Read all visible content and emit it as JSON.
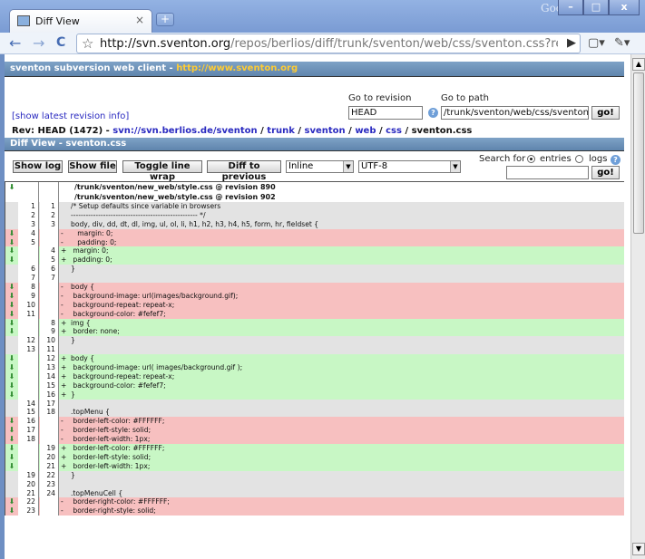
{
  "browser": {
    "tab_title": "Diff View",
    "tab_close": "×",
    "new_tab": "+",
    "brand": "Google",
    "win_minimize": "–",
    "win_maximize": "□",
    "win_close": "x",
    "back": "←",
    "forward": "→",
    "reload": "C",
    "url_host": "http://svn.sventon.org",
    "url_rest": "/repos/berlios/diff/trunk/sventon/web/css/sventon.css?revision=HEAD&_entries",
    "page_menu": "▶",
    "doc_menu": "▾",
    "wrench_menu": "▾"
  },
  "header": {
    "prefix": "sventon subversion web client - ",
    "site": "http://www.sventon.org"
  },
  "goto": {
    "revision_label": "Go to revision",
    "revision_value": "HEAD",
    "path_label": "Go to path",
    "path_value": "/trunk/sventon/web/css/sventon.css",
    "go_label": "go!",
    "help": "?"
  },
  "show_latest": "[show latest revision info]",
  "rev": {
    "prefix": "Rev: HEAD (1472) - ",
    "repo": "svn://svn.berlios.de/sventon",
    "sep": " / ",
    "crumbs": [
      "trunk",
      "sventon",
      "web",
      "css"
    ],
    "file": "sventon.css"
  },
  "diff_title": "Diff View - sventon.css",
  "actions": {
    "show_log": "Show log",
    "show_file": "Show file",
    "toggle_wrap": "Toggle line wrap",
    "diff_prev": "Diff to previous",
    "style_select": "Inline",
    "charset_select": "UTF-8"
  },
  "search": {
    "label": "Search for",
    "entries": "entries",
    "logs": "logs",
    "go_label": "go!",
    "help": "?"
  },
  "diff": {
    "file_from": "/trunk/sventon/new_web/style.css @ revision 890",
    "file_to": "/trunk/sventon/new_web/style.css @ revision 902",
    "rows": [
      {
        "t": "same",
        "l": "1",
        "r": "1",
        "s": "",
        "c": "/* Setup defaults since variable in browsers"
      },
      {
        "t": "same",
        "l": "2",
        "r": "2",
        "s": "",
        "c": "--------------------------------------------------- */"
      },
      {
        "t": "same",
        "l": "3",
        "r": "3",
        "s": "",
        "c": "body, div, dd, dt, dl, img, ul, ol, li, h1, h2, h3, h4, h5, form, hr, fieldset {"
      },
      {
        "t": "del",
        "l": "4",
        "r": "",
        "s": "-",
        "c": "   margin: 0;"
      },
      {
        "t": "del",
        "l": "5",
        "r": "",
        "s": "-",
        "c": "   padding: 0;"
      },
      {
        "t": "add",
        "l": "",
        "r": "4",
        "s": "+",
        "c": " margin: 0;"
      },
      {
        "t": "add",
        "l": "",
        "r": "5",
        "s": "+",
        "c": " padding: 0;"
      },
      {
        "t": "same",
        "l": "6",
        "r": "6",
        "s": "",
        "c": "}"
      },
      {
        "t": "same",
        "l": "7",
        "r": "7",
        "s": "",
        "c": ""
      },
      {
        "t": "del",
        "l": "8",
        "r": "",
        "s": "-",
        "c": "body {"
      },
      {
        "t": "del",
        "l": "9",
        "r": "",
        "s": "-",
        "c": " background-image: url(images/background.gif);"
      },
      {
        "t": "del",
        "l": "10",
        "r": "",
        "s": "-",
        "c": " background-repeat: repeat-x;"
      },
      {
        "t": "del",
        "l": "11",
        "r": "",
        "s": "-",
        "c": " background-color: #fefef7;"
      },
      {
        "t": "add",
        "l": "",
        "r": "8",
        "s": "+",
        "c": "img {"
      },
      {
        "t": "add",
        "l": "",
        "r": "9",
        "s": "+",
        "c": " border: none;"
      },
      {
        "t": "same",
        "l": "12",
        "r": "10",
        "s": "",
        "c": "}"
      },
      {
        "t": "same",
        "l": "13",
        "r": "11",
        "s": "",
        "c": ""
      },
      {
        "t": "add",
        "l": "",
        "r": "12",
        "s": "+",
        "c": "body {"
      },
      {
        "t": "add",
        "l": "",
        "r": "13",
        "s": "+",
        "c": " background-image: url( images/background.gif );"
      },
      {
        "t": "add",
        "l": "",
        "r": "14",
        "s": "+",
        "c": " background-repeat: repeat-x;"
      },
      {
        "t": "add",
        "l": "",
        "r": "15",
        "s": "+",
        "c": " background-color: #fefef7;"
      },
      {
        "t": "add",
        "l": "",
        "r": "16",
        "s": "+",
        "c": "}"
      },
      {
        "t": "same",
        "l": "14",
        "r": "17",
        "s": "",
        "c": ""
      },
      {
        "t": "same",
        "l": "15",
        "r": "18",
        "s": "",
        "c": ".topMenu {"
      },
      {
        "t": "del",
        "l": "16",
        "r": "",
        "s": "-",
        "c": " border-left-color: #FFFFFF;"
      },
      {
        "t": "del",
        "l": "17",
        "r": "",
        "s": "-",
        "c": " border-left-style: solid;"
      },
      {
        "t": "del",
        "l": "18",
        "r": "",
        "s": "-",
        "c": " border-left-width: 1px;"
      },
      {
        "t": "add",
        "l": "",
        "r": "19",
        "s": "+",
        "c": " border-left-color: #FFFFFF;"
      },
      {
        "t": "add",
        "l": "",
        "r": "20",
        "s": "+",
        "c": " border-left-style: solid;"
      },
      {
        "t": "add",
        "l": "",
        "r": "21",
        "s": "+",
        "c": " border-left-width: 1px;"
      },
      {
        "t": "same",
        "l": "19",
        "r": "22",
        "s": "",
        "c": "}"
      },
      {
        "t": "same",
        "l": "20",
        "r": "23",
        "s": "",
        "c": ""
      },
      {
        "t": "same",
        "l": "21",
        "r": "24",
        "s": "",
        "c": ".topMenuCell {"
      },
      {
        "t": "del",
        "l": "22",
        "r": "",
        "s": "-",
        "c": " border-right-color: #FFFFFF;"
      },
      {
        "t": "del",
        "l": "23",
        "r": "",
        "s": "-",
        "c": " border-right-style: solid;"
      }
    ]
  }
}
